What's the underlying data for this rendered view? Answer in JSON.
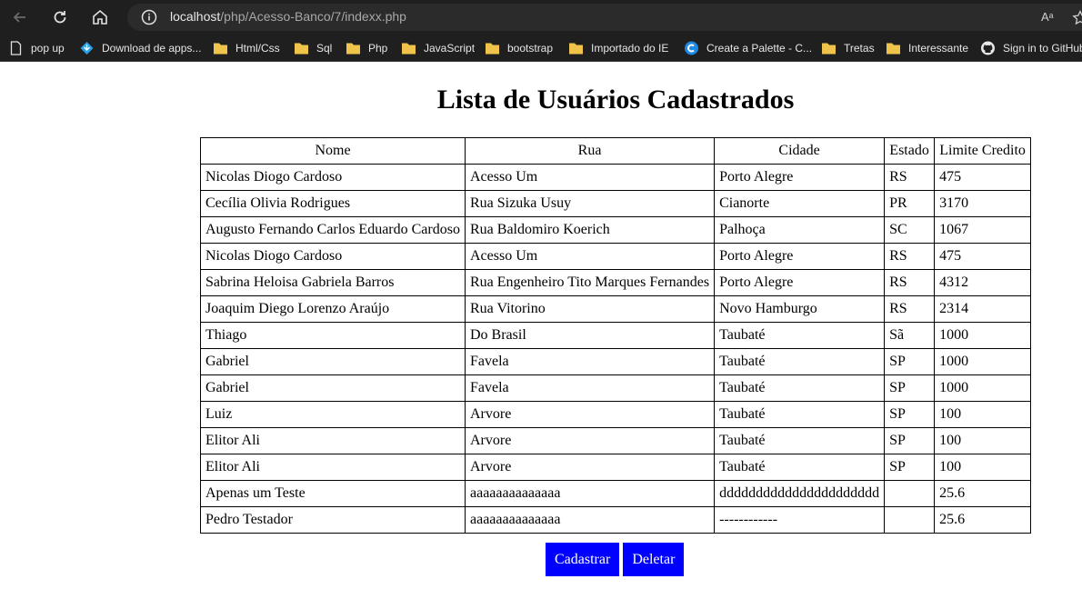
{
  "browser": {
    "url_host": "localhost",
    "url_path": "/php/Acesso-Banco/7/indexx.php",
    "read_aloud_label": "Aᵃ",
    "bookmarks": [
      {
        "label": "pop up",
        "icon": "page-icon"
      },
      {
        "label": "Download de apps...",
        "icon": "download-icon"
      },
      {
        "label": "Html/Css",
        "icon": "folder-icon"
      },
      {
        "label": "Sql",
        "icon": "folder-icon"
      },
      {
        "label": "Php",
        "icon": "folder-icon"
      },
      {
        "label": "JavaScript",
        "icon": "folder-icon"
      },
      {
        "label": "bootstrap",
        "icon": "folder-icon"
      },
      {
        "label": "Importado do IE",
        "icon": "folder-icon"
      },
      {
        "label": "Create a Palette - C...",
        "icon": "palette-site-icon"
      },
      {
        "label": "Tretas",
        "icon": "folder-icon"
      },
      {
        "label": "Interessante",
        "icon": "folder-icon"
      },
      {
        "label": "Sign in to GitHub",
        "icon": "github-icon"
      }
    ]
  },
  "page": {
    "title": "Lista de Usuários Cadastrados",
    "columns": [
      "Nome",
      "Rua",
      "Cidade",
      "Estado",
      "Limite Credito"
    ],
    "rows": [
      [
        "Nicolas Diogo Cardoso",
        "Acesso Um",
        "Porto Alegre",
        "RS",
        "475"
      ],
      [
        "Cecília Olivia Rodrigues",
        "Rua Sizuka Usuy",
        "Cianorte",
        "PR",
        "3170"
      ],
      [
        "Augusto Fernando Carlos Eduardo Cardoso",
        "Rua Baldomiro Koerich",
        "Palhoça",
        "SC",
        "1067"
      ],
      [
        "Nicolas Diogo Cardoso",
        "Acesso Um",
        "Porto Alegre",
        "RS",
        "475"
      ],
      [
        "Sabrina Heloisa Gabriela Barros",
        "Rua Engenheiro Tito Marques Fernandes",
        "Porto Alegre",
        "RS",
        "4312"
      ],
      [
        "Joaquim Diego Lorenzo Araújo",
        "Rua Vitorino",
        "Novo Hamburgo",
        "RS",
        "2314"
      ],
      [
        "Thiago",
        "Do Brasil",
        "Taubaté",
        "Sã",
        "1000"
      ],
      [
        "Gabriel",
        "Favela",
        "Taubaté",
        "SP",
        "1000"
      ],
      [
        "Gabriel",
        "Favela",
        "Taubaté",
        "SP",
        "1000"
      ],
      [
        "Luiz",
        "Arvore",
        "Taubaté",
        "SP",
        "100"
      ],
      [
        "Elitor Ali",
        "Arvore",
        "Taubaté",
        "SP",
        "100"
      ],
      [
        "Elitor Ali",
        "Arvore",
        "Taubaté",
        "SP",
        "100"
      ],
      [
        "Apenas um Teste",
        "aaaaaaaaaaaaaa",
        "dddddddddddddddddddddd",
        "",
        "25.6"
      ],
      [
        "Pedro Testador",
        "aaaaaaaaaaaaaa",
        "------------",
        "",
        "25.6"
      ]
    ],
    "buttons": {
      "register": "Cadastrar",
      "delete": "Deletar"
    }
  },
  "colors": {
    "chrome_bg": "#1f1f1f",
    "button_bg": "#0000ff",
    "folder": "#f0c44a"
  }
}
